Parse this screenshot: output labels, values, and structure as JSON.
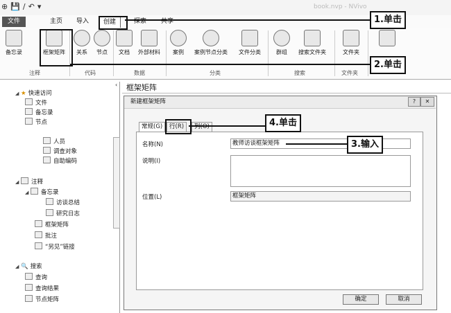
{
  "window": {
    "quick_access": [
      "⊕",
      "💾",
      "∕",
      "↶",
      "▾"
    ],
    "doc_title": "book.nvp - NVivo"
  },
  "tabs": [
    {
      "id": "file",
      "label": "文件"
    },
    {
      "id": "home",
      "label": "主页"
    },
    {
      "id": "import",
      "label": "导入"
    },
    {
      "id": "create",
      "label": "创建"
    },
    {
      "id": "explore",
      "label": "探索"
    },
    {
      "id": "share",
      "label": "共享"
    }
  ],
  "ribbon": {
    "buttons": [
      {
        "id": "memo",
        "label": "备忘录"
      },
      {
        "id": "framework-matrix",
        "label": "框架矩阵"
      },
      {
        "id": "relationship",
        "label": "关系"
      },
      {
        "id": "node",
        "label": "节点"
      },
      {
        "id": "document",
        "label": "文档"
      },
      {
        "id": "external",
        "label": "外部材料"
      },
      {
        "id": "case",
        "label": "案例"
      },
      {
        "id": "case-node-class",
        "label": "案例节点分类"
      },
      {
        "id": "file-class",
        "label": "文件分类"
      },
      {
        "id": "group",
        "label": "群组"
      },
      {
        "id": "search-folder",
        "label": "搜索文件夹"
      },
      {
        "id": "folder",
        "label": "文件夹"
      }
    ],
    "groups": [
      "注释",
      "代码",
      "数据",
      "分类",
      "搜索",
      "文件夹"
    ]
  },
  "nav": {
    "quick_access": "快速访问",
    "items_top": [
      "文件",
      "备忘录",
      "节点"
    ],
    "items_mid": [
      "人员",
      "调查对象",
      "自助编码"
    ],
    "notes": "注释",
    "memo": "备忘录",
    "memo_children": [
      "访谈总结",
      "研究日志"
    ],
    "framework": "框架矩阵",
    "annotation": "批注",
    "see_also": "“另见”链接",
    "search": "搜索",
    "search_children": [
      "查询",
      "查询结果",
      "节点矩阵"
    ]
  },
  "content": {
    "title": "框架矩阵"
  },
  "dialog": {
    "title": "新建框架矩阵",
    "help": "?",
    "close": "✕",
    "tabs": [
      "常规(G)",
      "行(R)",
      "列(O)"
    ],
    "name_label": "名称(N)",
    "name_value": "教师访谈框架矩阵",
    "desc_label": "说明(I)",
    "desc_value": "",
    "location_label": "位置(L)",
    "location_value": "框架矩阵",
    "ok": "确定",
    "cancel": "取消"
  },
  "callouts": {
    "c1": "1.单击",
    "c2": "2.单击",
    "c3": "3.输入",
    "c4": "4.单击"
  }
}
